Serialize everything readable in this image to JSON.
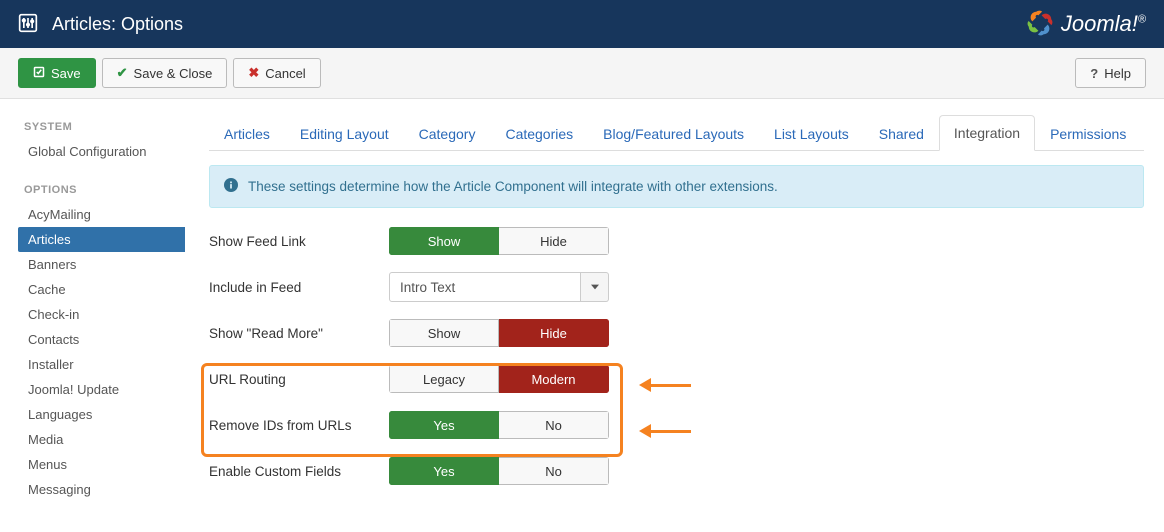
{
  "topbar": {
    "title": "Articles: Options"
  },
  "brand": {
    "name": "Joomla!",
    "reg": "®"
  },
  "toolbar": {
    "save": "Save",
    "save_close": "Save & Close",
    "cancel": "Cancel",
    "help": "Help"
  },
  "sidebar": {
    "groups": [
      {
        "header": "SYSTEM",
        "items": [
          {
            "label": "Global Configuration",
            "active": false
          }
        ]
      },
      {
        "header": "OPTIONS",
        "items": [
          {
            "label": "AcyMailing",
            "active": false
          },
          {
            "label": "Articles",
            "active": true
          },
          {
            "label": "Banners",
            "active": false
          },
          {
            "label": "Cache",
            "active": false
          },
          {
            "label": "Check-in",
            "active": false
          },
          {
            "label": "Contacts",
            "active": false
          },
          {
            "label": "Installer",
            "active": false
          },
          {
            "label": "Joomla! Update",
            "active": false
          },
          {
            "label": "Languages",
            "active": false
          },
          {
            "label": "Media",
            "active": false
          },
          {
            "label": "Menus",
            "active": false
          },
          {
            "label": "Messaging",
            "active": false
          }
        ]
      }
    ]
  },
  "tabs": [
    {
      "label": "Articles",
      "active": false
    },
    {
      "label": "Editing Layout",
      "active": false
    },
    {
      "label": "Category",
      "active": false
    },
    {
      "label": "Categories",
      "active": false
    },
    {
      "label": "Blog/Featured Layouts",
      "active": false
    },
    {
      "label": "List Layouts",
      "active": false
    },
    {
      "label": "Shared",
      "active": false
    },
    {
      "label": "Integration",
      "active": true
    },
    {
      "label": "Permissions",
      "active": false
    }
  ],
  "info_text": "These settings determine how the Article Component will integrate with other extensions.",
  "rows": {
    "show_feed_link": {
      "label": "Show Feed Link",
      "opts": [
        "Show",
        "Hide"
      ],
      "selected": 0,
      "sel_style": "green"
    },
    "include_in_feed": {
      "label": "Include in Feed",
      "value": "Intro Text"
    },
    "show_read_more": {
      "label": "Show \"Read More\"",
      "opts": [
        "Show",
        "Hide"
      ],
      "selected": 1,
      "sel_style": "red"
    },
    "url_routing": {
      "label": "URL Routing",
      "opts": [
        "Legacy",
        "Modern"
      ],
      "selected": 1,
      "sel_style": "red"
    },
    "remove_ids": {
      "label": "Remove IDs from URLs",
      "opts": [
        "Yes",
        "No"
      ],
      "selected": 0,
      "sel_style": "green"
    },
    "enable_custom_fields": {
      "label": "Enable Custom Fields",
      "opts": [
        "Yes",
        "No"
      ],
      "selected": 0,
      "sel_style": "green"
    }
  }
}
